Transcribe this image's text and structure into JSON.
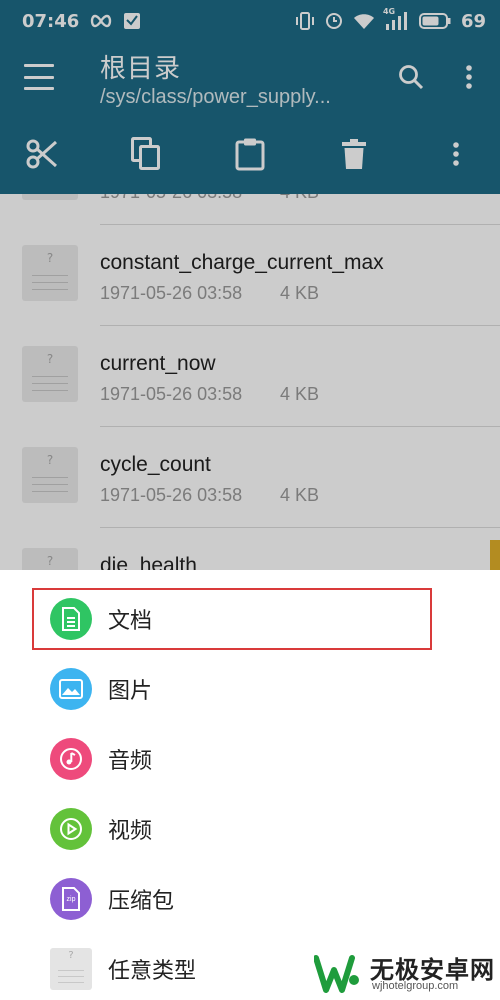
{
  "status_bar": {
    "time": "07:46",
    "battery": "69",
    "network": "4G",
    "icons": [
      "infinity-icon",
      "notification-icon",
      "vibrate-icon",
      "alarm-icon",
      "wifi-icon",
      "signal-icon",
      "battery-icon"
    ]
  },
  "app_bar": {
    "title": "根目录",
    "path": "/sys/class/power_supply...",
    "icons": [
      "menu-icon",
      "search-icon",
      "more-vert-icon"
    ]
  },
  "toolbar": {
    "icons": [
      "cut-icon",
      "copy-icon",
      "paste-icon",
      "delete-icon",
      "more-vert-icon"
    ]
  },
  "files": [
    {
      "name": "",
      "date": "1971-05-26 03:58",
      "size": "4 KB"
    },
    {
      "name": "constant_charge_current_max",
      "date": "1971-05-26 03:58",
      "size": "4 KB"
    },
    {
      "name": "current_now",
      "date": "1971-05-26 03:58",
      "size": "4 KB"
    },
    {
      "name": "cycle_count",
      "date": "1971-05-26 03:58",
      "size": "4 KB"
    },
    {
      "name": "die_health",
      "date": "",
      "size": ""
    }
  ],
  "file_icon_glyph": "?",
  "sheet": {
    "items": [
      {
        "label": "文档",
        "color": "#2fc563",
        "icon": "document-icon"
      },
      {
        "label": "图片",
        "color": "#3db4f0",
        "icon": "image-icon"
      },
      {
        "label": "音频",
        "color": "#ee4a7c",
        "icon": "music-icon"
      },
      {
        "label": "视频",
        "color": "#63c23a",
        "icon": "video-icon"
      },
      {
        "label": "压缩包",
        "color": "#8d5fd3",
        "icon": "zip-icon"
      },
      {
        "label": "任意类型",
        "color": "#e4e4e4",
        "icon": "unknown-file-icon"
      }
    ],
    "zip_glyph": "zip"
  },
  "watermark": {
    "name": "无极安卓网",
    "url": "wjhotelgroup.com"
  },
  "colors": {
    "primary": "#1d6b86",
    "highlight_border": "#d93a3a"
  }
}
